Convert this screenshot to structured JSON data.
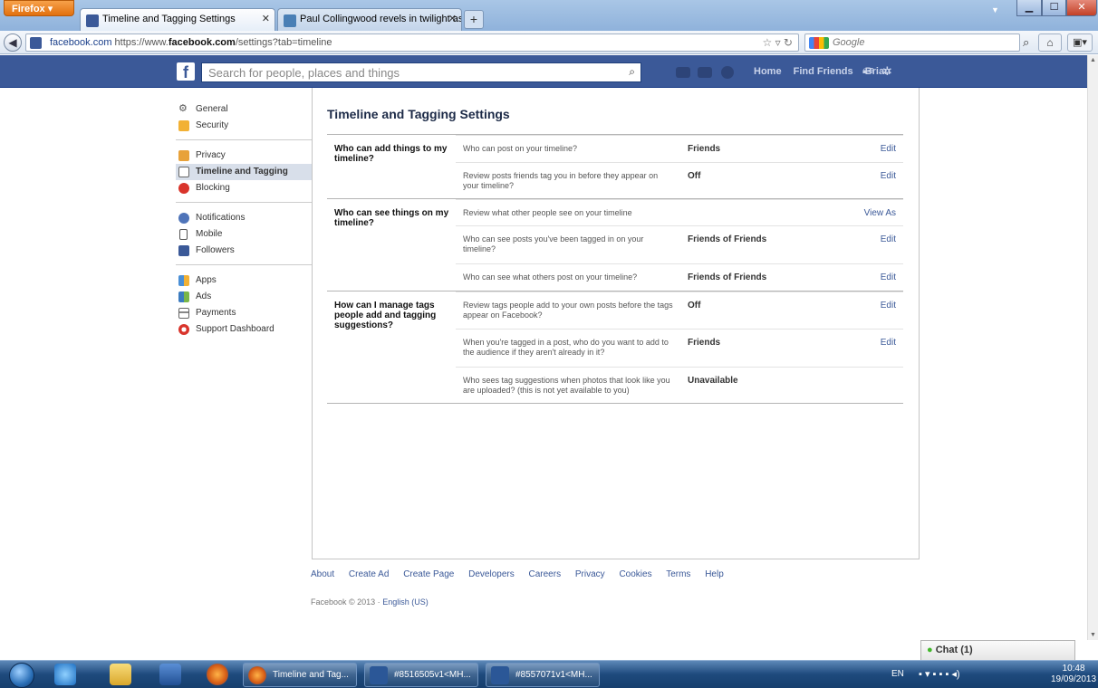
{
  "browser": {
    "firefox_label": "Firefox",
    "tabs": [
      {
        "label": "Timeline and Tagging Settings",
        "active": true
      },
      {
        "label": "Paul Collingwood revels in twilight as...",
        "active": false
      }
    ],
    "new_tab": "+",
    "url_site": "facebook.com",
    "url_prefix": "https://www.",
    "url_domain": "facebook.com",
    "url_path": "/settings?tab=timeline",
    "search_placeholder": "Google"
  },
  "fb_header": {
    "logo": "f",
    "search_placeholder": "Search for people, places and things",
    "nav": {
      "home": "Home",
      "find_friends": "Find Friends",
      "user": "Brian"
    },
    "brand_color": "#3b5998"
  },
  "sidebar": {
    "groups": [
      [
        {
          "label": "General",
          "icon": "gear-icon"
        },
        {
          "label": "Security",
          "icon": "shield-icon"
        }
      ],
      [
        {
          "label": "Privacy",
          "icon": "lock-icon"
        },
        {
          "label": "Timeline and Tagging",
          "icon": "timeline-icon",
          "active": true
        },
        {
          "label": "Blocking",
          "icon": "block-icon"
        }
      ],
      [
        {
          "label": "Notifications",
          "icon": "globe-icon"
        },
        {
          "label": "Mobile",
          "icon": "mobile-icon"
        },
        {
          "label": "Followers",
          "icon": "rss-icon"
        }
      ],
      [
        {
          "label": "Apps",
          "icon": "apps-icon"
        },
        {
          "label": "Ads",
          "icon": "ads-icon"
        },
        {
          "label": "Payments",
          "icon": "card-icon"
        },
        {
          "label": "Support Dashboard",
          "icon": "lifebuoy-icon"
        }
      ]
    ]
  },
  "main": {
    "title": "Timeline and Tagging Settings",
    "sections": [
      {
        "heading": "Who can add things to my timeline?",
        "rows": [
          {
            "question": "Who can post on your timeline?",
            "value": "Friends",
            "action": "Edit"
          },
          {
            "question": "Review posts friends tag you in before they appear on your timeline?",
            "value": "Off",
            "action": "Edit"
          }
        ]
      },
      {
        "heading": "Who can see things on my timeline?",
        "rows": [
          {
            "question": "Review what other people see on your timeline",
            "value": "",
            "action": "View As"
          },
          {
            "question": "Who can see posts you've been tagged in on your timeline?",
            "value": "Friends of Friends",
            "action": "Edit"
          },
          {
            "question": "Who can see what others post on your timeline?",
            "value": "Friends of Friends",
            "action": "Edit"
          }
        ]
      },
      {
        "heading": "How can I manage tags people add and tagging suggestions?",
        "rows": [
          {
            "question": "Review tags people add to your own posts before the tags appear on Facebook?",
            "value": "Off",
            "action": "Edit"
          },
          {
            "question": "When you're tagged in a post, who do you want to add to the audience if they aren't already in it?",
            "value": "Friends",
            "action": "Edit"
          },
          {
            "question": "Who sees tag suggestions when photos that look like you are uploaded? (this is not yet available to you)",
            "value": "Unavailable",
            "action": ""
          }
        ]
      }
    ]
  },
  "footer": {
    "links": [
      "About",
      "Create Ad",
      "Create Page",
      "Developers",
      "Careers",
      "Privacy",
      "Cookies",
      "Terms",
      "Help"
    ],
    "copyright": "Facebook © 2013 · ",
    "language": "English (US)"
  },
  "chat": {
    "label": "Chat (1)"
  },
  "taskbar": {
    "tasks": [
      {
        "label": "Timeline and Tag...",
        "icon": "firefox-icon"
      },
      {
        "label": "#8516505v1<MH...",
        "icon": "word-icon"
      },
      {
        "label": "#8557071v1<MH...",
        "icon": "word-icon"
      }
    ],
    "language": "EN",
    "time": "10:48",
    "date": "19/09/2013"
  }
}
